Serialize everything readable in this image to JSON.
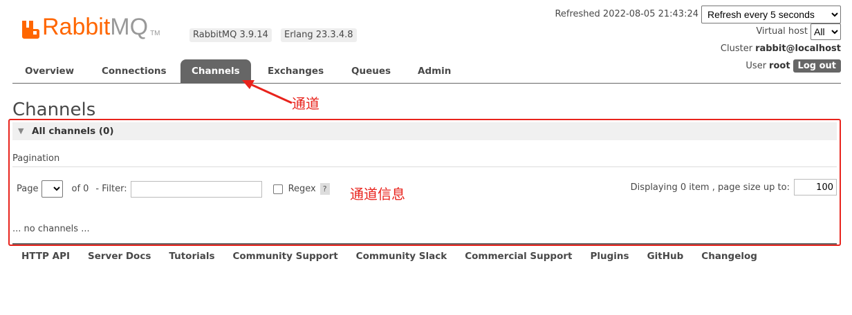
{
  "logo": {
    "rabbit": "Rabbit",
    "mq": "MQ",
    "tm": "TM"
  },
  "versions": {
    "rabbitmq": "RabbitMQ 3.9.14",
    "erlang": "Erlang 23.3.4.8"
  },
  "header": {
    "refreshed": "Refreshed 2022-08-05 21:43:24",
    "refresh_select": "Refresh every 5 seconds",
    "vhost_label": "Virtual host",
    "vhost_value": "All",
    "cluster_label": "Cluster",
    "cluster_value": "rabbit@localhost",
    "user_label": "User",
    "user_value": "root",
    "logout": "Log out"
  },
  "tabs": [
    {
      "label": "Overview"
    },
    {
      "label": "Connections"
    },
    {
      "label": "Channels"
    },
    {
      "label": "Exchanges"
    },
    {
      "label": "Queues"
    },
    {
      "label": "Admin"
    }
  ],
  "annotations": {
    "tab_note": "通道",
    "box_note": "通道信息"
  },
  "page": {
    "title": "Channels",
    "section": "All channels (0)",
    "pagination_label": "Pagination",
    "page_label": "Page",
    "of_label": "of 0",
    "filter_label": "- Filter:",
    "regex_label": "Regex",
    "help": "?",
    "displaying": "Displaying 0 item , page size up to:",
    "page_size": "100",
    "empty": "... no channels ..."
  },
  "footer": [
    "HTTP API",
    "Server Docs",
    "Tutorials",
    "Community Support",
    "Community Slack",
    "Commercial Support",
    "Plugins",
    "GitHub",
    "Changelog"
  ],
  "colors": {
    "brand": "#ff6600",
    "annotation": "#e8231c",
    "tab_active": "#666666"
  }
}
